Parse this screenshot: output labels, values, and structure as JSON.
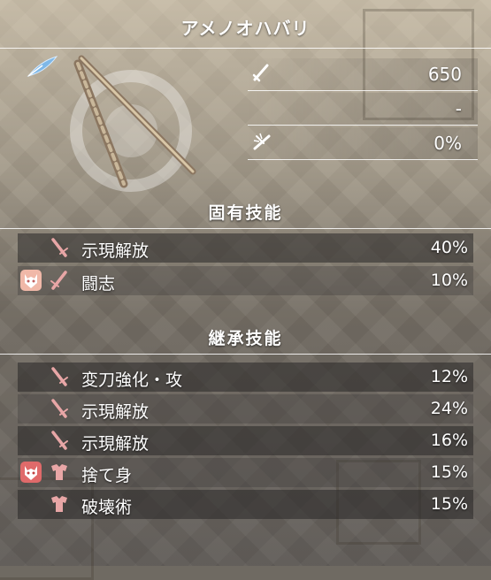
{
  "weapon": {
    "name": "アメノオハバリ",
    "rarity_icon": "feather-icon"
  },
  "stats": [
    {
      "icon": "attack-sword-icon",
      "value": "650"
    },
    {
      "icon": "none",
      "value": "-"
    },
    {
      "icon": "critical-icon",
      "value": "0%"
    }
  ],
  "sections": {
    "innate": "固有技能",
    "inherited": "継承技能"
  },
  "innate_skills": [
    {
      "mask": "",
      "type": "katana-icon",
      "name": "示現解放",
      "percent": "40%"
    },
    {
      "mask": "oni-mask-icon",
      "type": "katana-icon",
      "name": "闘志",
      "percent": "10%"
    }
  ],
  "inherited_skills": [
    {
      "mask": "",
      "type": "katana-icon",
      "name": "変刀強化・攻",
      "percent": "12%"
    },
    {
      "mask": "",
      "type": "katana-icon",
      "name": "示現解放",
      "percent": "24%"
    },
    {
      "mask": "",
      "type": "katana-icon",
      "name": "示現解放",
      "percent": "16%"
    },
    {
      "mask": "oni-mask-icon",
      "type": "armor-icon",
      "name": "捨て身",
      "percent": "15%"
    },
    {
      "mask": "",
      "type": "armor-icon",
      "name": "破壊術",
      "percent": "15%"
    }
  ],
  "colors": {
    "icon_pink": "#e8a6a6",
    "mask_bg": "#f0b8a8",
    "feather_blue": "#7fb8e8"
  }
}
